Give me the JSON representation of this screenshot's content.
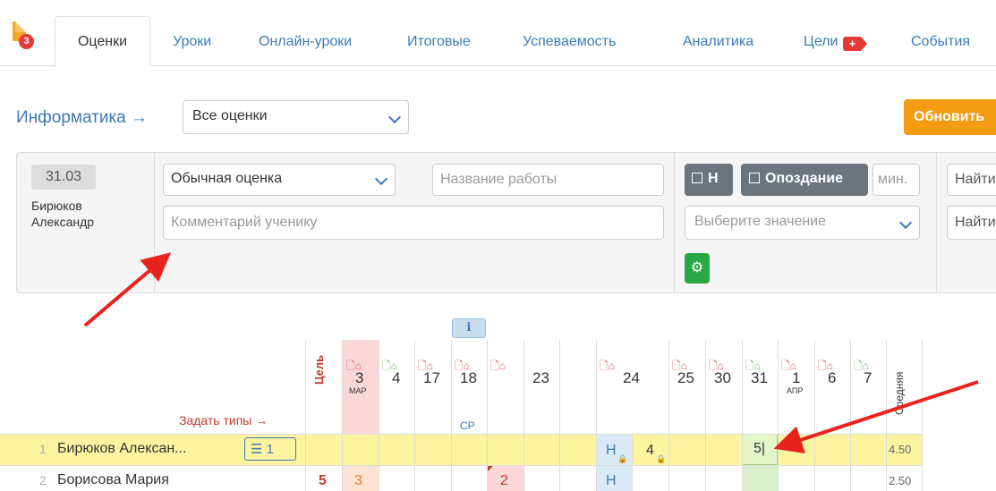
{
  "header": {
    "badge_count": "3"
  },
  "tabs": [
    {
      "label": "Оценки",
      "active": true
    },
    {
      "label": "Уроки"
    },
    {
      "label": "Онлайн-уроки"
    },
    {
      "label": "Итоговые"
    },
    {
      "label": "Успеваемость"
    },
    {
      "label": "Аналитика"
    },
    {
      "label": "Цели"
    },
    {
      "label": "События"
    }
  ],
  "subject": {
    "title": "Информатика →",
    "filter_value": "Все оценки",
    "refresh_label": "Обновить"
  },
  "editor": {
    "date": "31.03",
    "student_name": "Бирюков Александр",
    "mark_type": "Обычная оценка",
    "work_name_placeholder": "Название работы",
    "comment_placeholder": "Комментарий ученику",
    "absent_label": "Н",
    "late_label": "Опоздание",
    "minutes_placeholder": "мин.",
    "value_placeholder": "Выберите значение",
    "search1": "Найти",
    "search2": "Найти"
  },
  "journal": {
    "goal_header": "Цель",
    "set_types_label": "Задать типы →",
    "average_header": "Средняя",
    "info_label": "i",
    "columns": [
      {
        "day": "3",
        "month": "МАР"
      },
      {
        "day": "4"
      },
      {
        "day": "17"
      },
      {
        "day": "18",
        "tag": "СР"
      },
      {
        "day": ""
      },
      {
        "day": "23"
      },
      {
        "day": "24"
      },
      {
        "day": "25"
      },
      {
        "day": "30"
      },
      {
        "day": "31"
      },
      {
        "day": "1",
        "month": "АПР"
      },
      {
        "day": "6"
      },
      {
        "day": "7"
      }
    ],
    "rows": [
      {
        "num": "1",
        "name": "Бирюков Алексан...",
        "goal_btn": "1",
        "marks": {
          "24a": "Н",
          "24b": "4",
          "31": "5|"
        },
        "average": "4.50"
      },
      {
        "num": "2",
        "name": "Борисова Мария",
        "goal": "5",
        "marks": {
          "3": "3",
          "18b": "2",
          "24a": "Н"
        },
        "average": "2.50"
      }
    ]
  },
  "colors": {
    "accent": "#3d7ab8",
    "orange": "#f39c12",
    "highlight": "#fdf4a0",
    "arrow": "#e8231d",
    "green": "#28a745"
  }
}
